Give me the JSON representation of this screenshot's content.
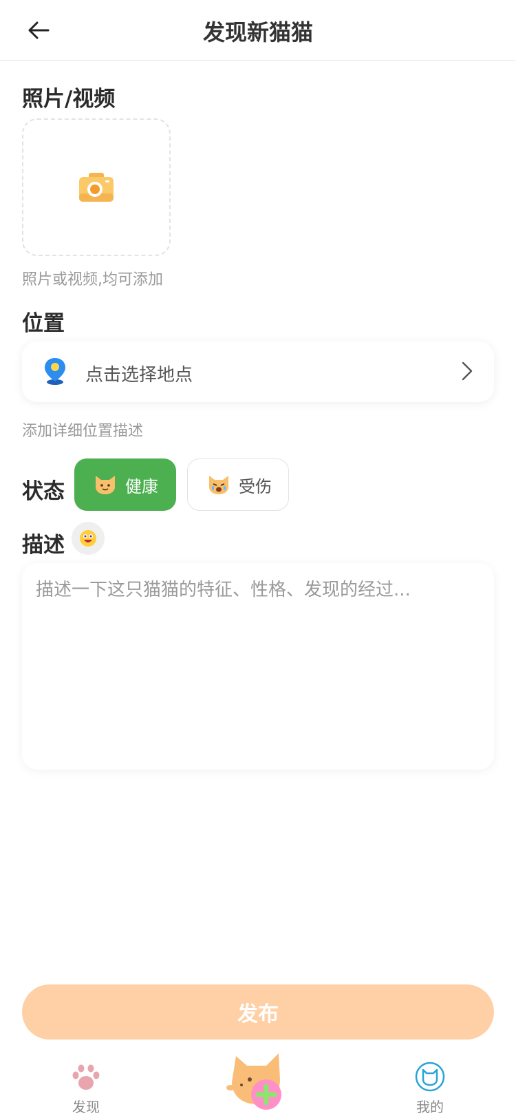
{
  "header": {
    "title": "发现新猫猫"
  },
  "photo_section": {
    "title": "照片/视频",
    "hint": "照片或视频,均可添加"
  },
  "location_section": {
    "title": "位置",
    "placeholder": "点击选择地点",
    "detail_hint": "添加详细位置描述"
  },
  "status_section": {
    "label": "状态",
    "options": [
      {
        "label": "健康",
        "selected": true
      },
      {
        "label": "受伤",
        "selected": false
      }
    ]
  },
  "description_section": {
    "label": "描述",
    "placeholder": "描述一下这只猫猫的特征、性格、发现的经过..."
  },
  "publish": {
    "label": "发布"
  },
  "tabbar": {
    "items": [
      {
        "label": "发现",
        "icon": "paw-icon"
      },
      {
        "label": "",
        "icon": "cat-add-icon"
      },
      {
        "label": "我的",
        "icon": "cat-face-icon"
      }
    ]
  },
  "colors": {
    "accent": "#4caf50",
    "publish_disabled": "#ffcfa5",
    "cat_orange": "#f9bd78",
    "pink": "#ff8fc7"
  }
}
